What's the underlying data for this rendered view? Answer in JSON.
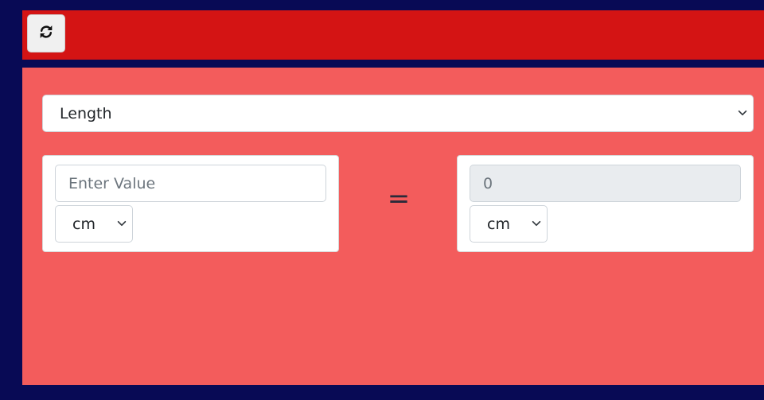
{
  "header": {
    "refresh_icon": "refresh-icon"
  },
  "converter": {
    "category_select": {
      "selected": "Length",
      "icon": "chevron-down-icon"
    },
    "from": {
      "value_placeholder": "Enter Value",
      "value": "",
      "unit_selected": "cm"
    },
    "equals_sign": "=",
    "to": {
      "result_value": "0",
      "unit_selected": "cm"
    }
  },
  "colors": {
    "page_background": "#080a55",
    "header_background": "#d41414",
    "content_background": "#f35c5c",
    "card_background": "#ffffff",
    "result_field_background": "#e9ecef"
  }
}
